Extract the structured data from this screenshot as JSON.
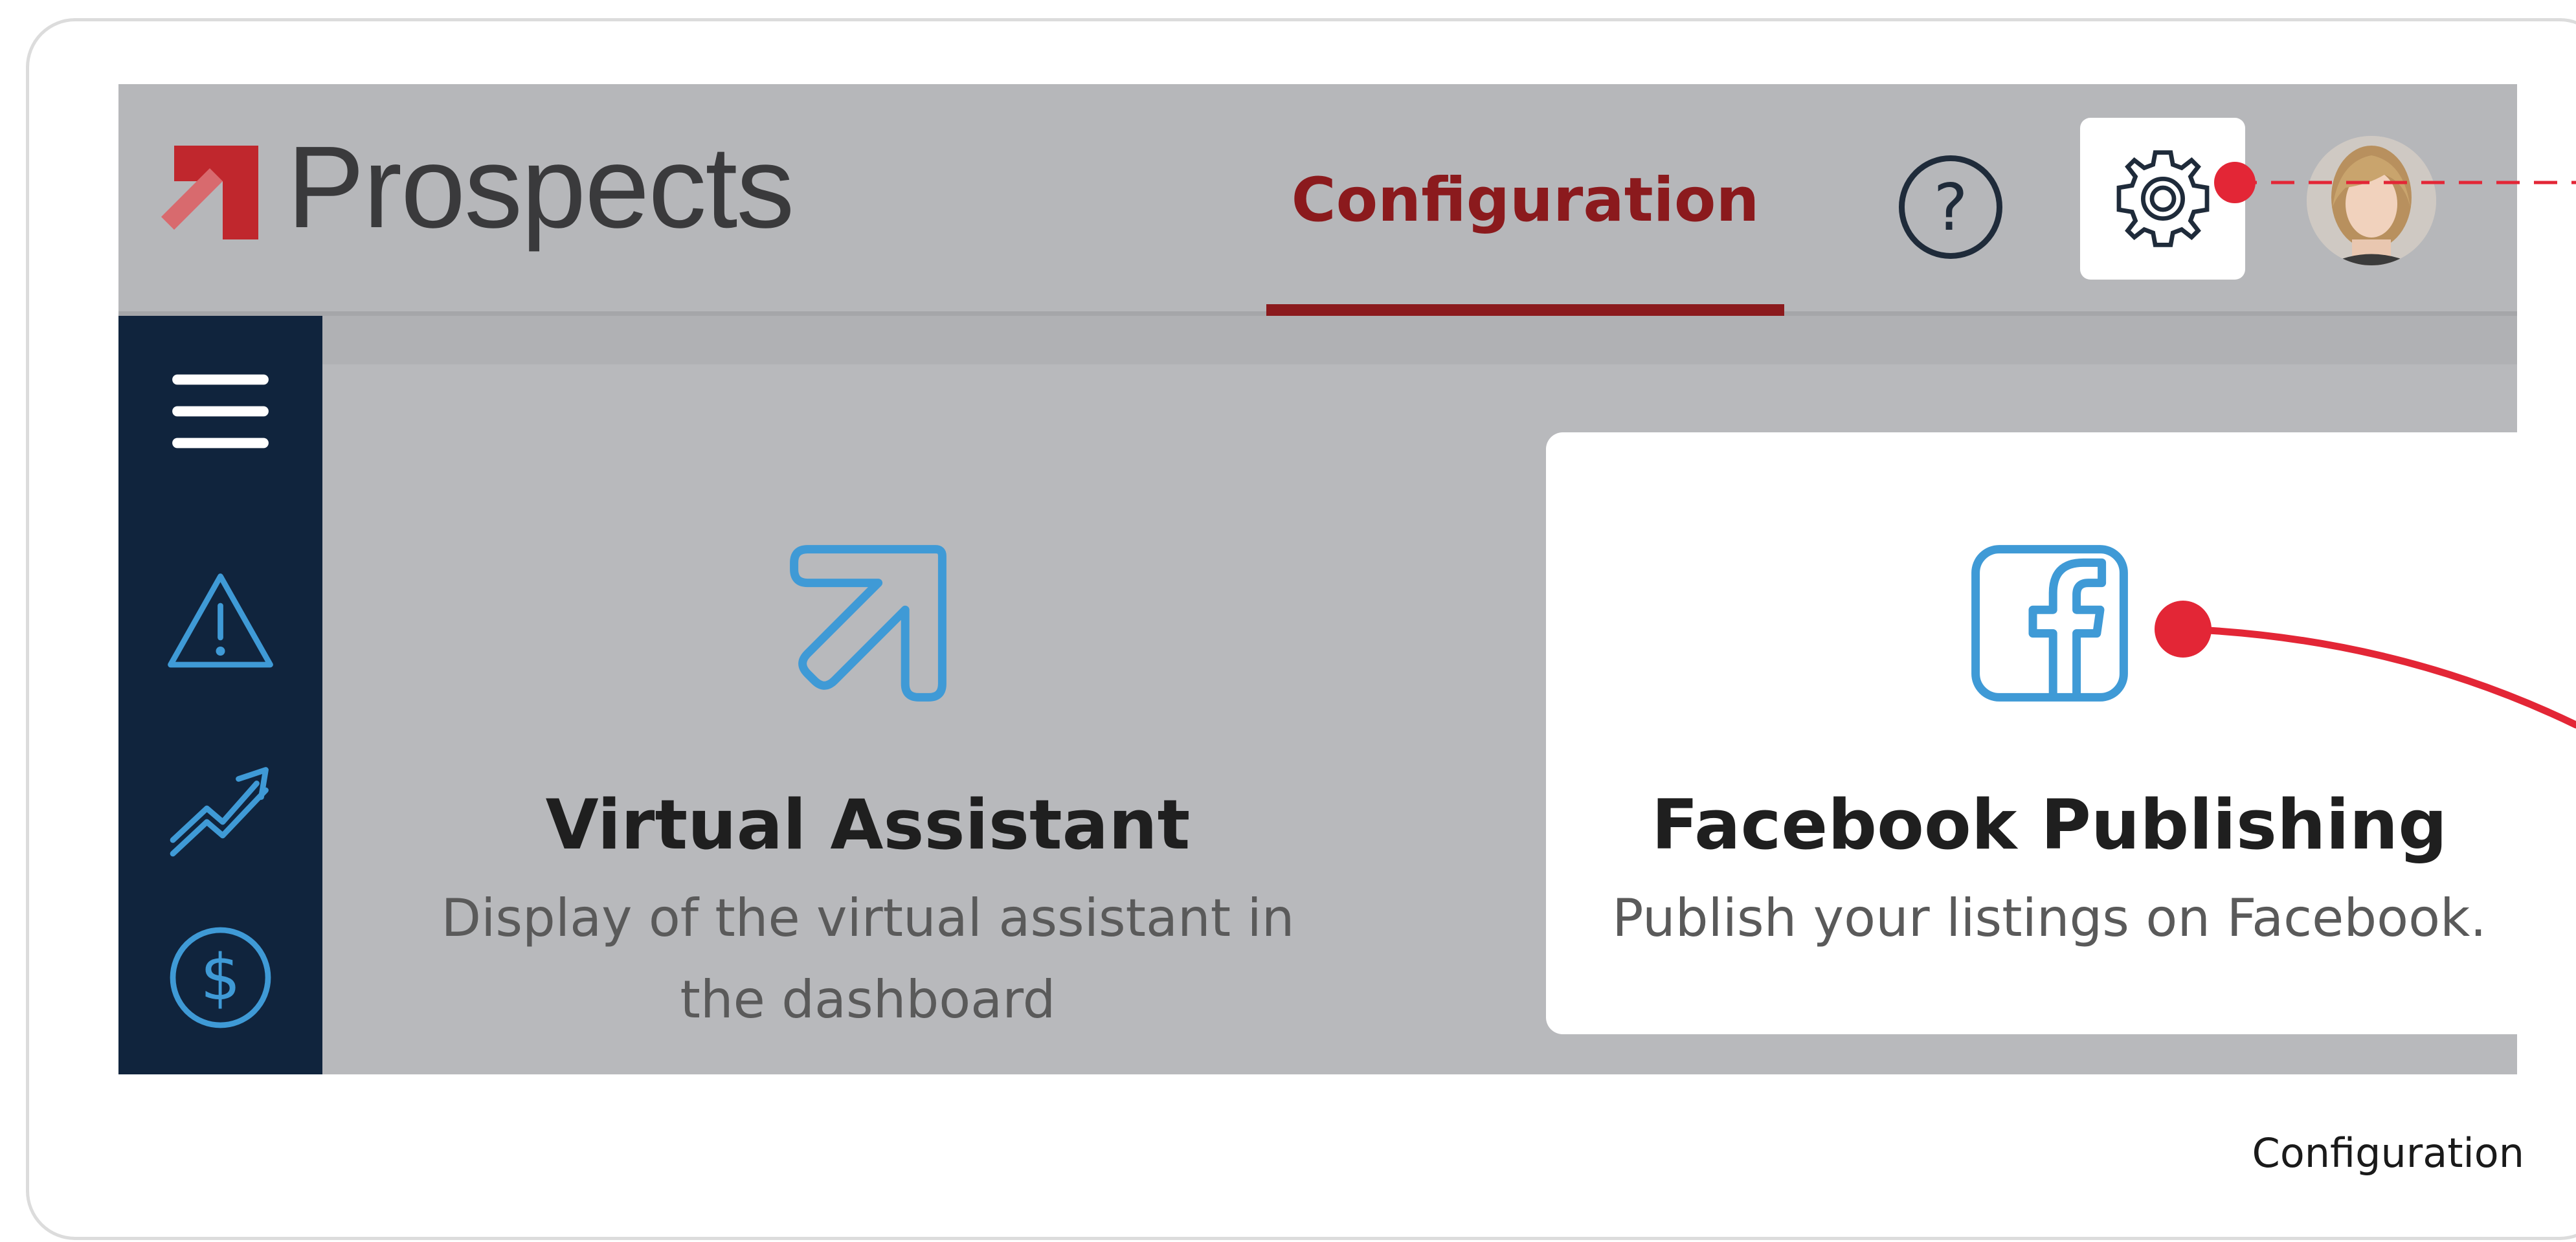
{
  "app": {
    "logo_text": "Prospects",
    "nav_tab_label": "Configuration",
    "help_glyph": "?"
  },
  "icons": {
    "logo": "prospects-logo-arrow",
    "help": "help-icon",
    "settings": "gear-icon",
    "menu": "hamburger-menu-icon",
    "alerts": "warning-triangle-icon",
    "trend": "trending-up-icon",
    "billing": "dollar-icon",
    "virtual_assistant": "arrow-up-right-icon",
    "facebook": "facebook-icon"
  },
  "cards": [
    {
      "title": "Virtual Assistant",
      "description": "Display of the virtual assistant in the dashboard"
    },
    {
      "title": "Facebook Publishing",
      "description": "Publish your listings on Facebook."
    }
  ],
  "caption": "Configuration",
  "colors": {
    "brand_red": "#8b1a1d",
    "annotation_red": "#e32636",
    "icon_blue": "#3f9ad6",
    "sidebar_navy": "#10243d"
  }
}
